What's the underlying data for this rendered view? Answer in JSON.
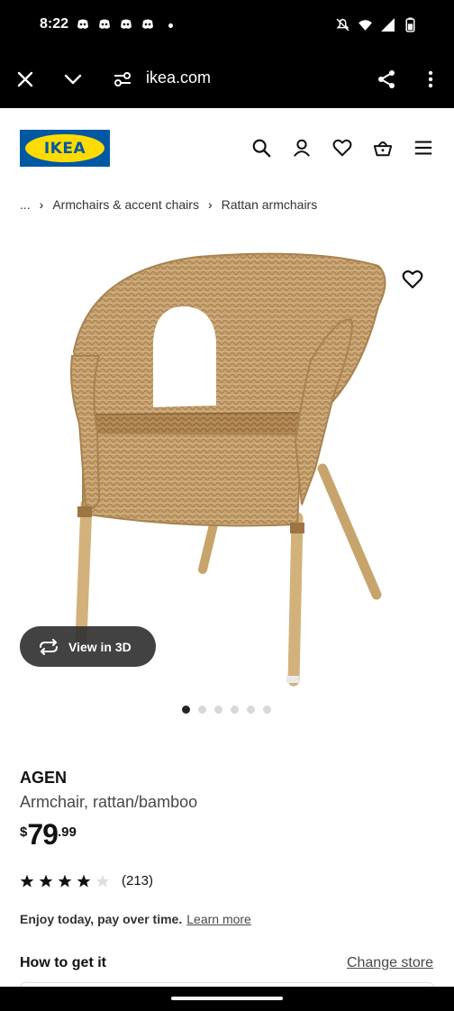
{
  "status_bar": {
    "time": "8:22",
    "notification_icons": [
      "discord-icon",
      "discord-icon",
      "discord-icon",
      "discord-icon"
    ],
    "system_icons": [
      "mute-icon",
      "wifi-icon",
      "signal-icon",
      "battery-icon"
    ]
  },
  "browser": {
    "url": "ikea.com",
    "icons": [
      "close-icon",
      "chevron-down-icon",
      "site-settings-icon",
      "share-icon",
      "more-icon"
    ]
  },
  "header": {
    "logo_text": "IKEA",
    "brand_colors": {
      "blue": "#0058a3",
      "yellow": "#ffdb00"
    },
    "icons": [
      "search-icon",
      "account-icon",
      "favourites-icon",
      "cart-icon",
      "menu-icon"
    ]
  },
  "breadcrumb": {
    "items": [
      "...",
      "Armchairs & accent chairs",
      "Rattan armchairs"
    ]
  },
  "gallery": {
    "view_3d_label": "View in 3D",
    "total_images": 6,
    "active_index": 0
  },
  "product": {
    "name": "AGEN",
    "description": "Armchair, rattan/bamboo",
    "price": {
      "currency": "$",
      "integer": "79",
      "decimal": ".99"
    },
    "rating": {
      "stars": 4,
      "max": 5,
      "count_label": "(213)"
    },
    "pay_text": "Enjoy today, pay over time.",
    "pay_link": "Learn more"
  },
  "fulfilment": {
    "title": "How to get it",
    "change_store": "Change store"
  }
}
